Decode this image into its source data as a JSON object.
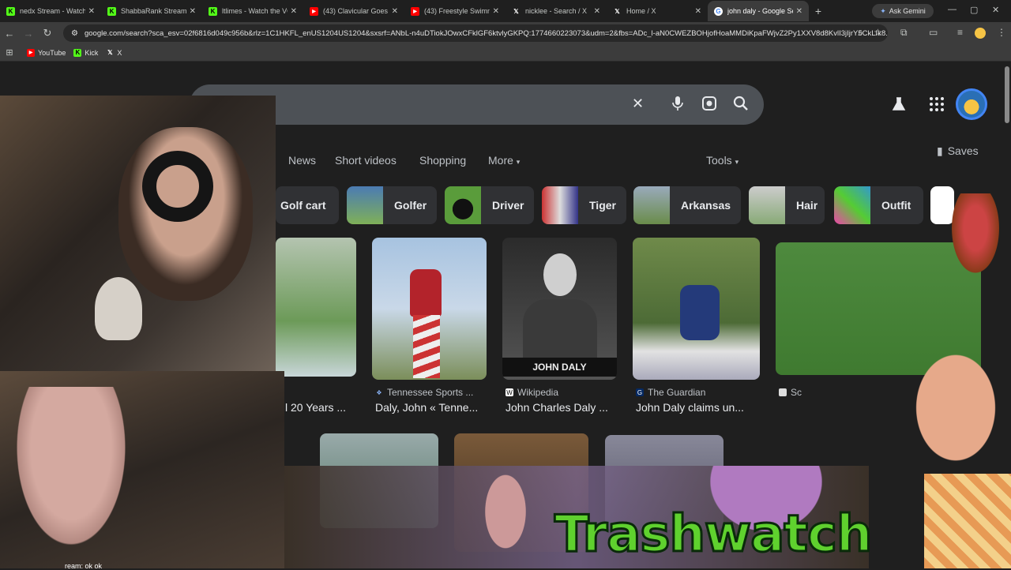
{
  "browser": {
    "tabs": [
      {
        "title": "nedx Stream - Watch L",
        "icon": "kick-icon",
        "color": "#53fc18",
        "active": false
      },
      {
        "title": "ShabbaRank Stream -",
        "icon": "kick-icon",
        "color": "#53fc18",
        "active": false
      },
      {
        "title": "ltlimes - Watch the VO",
        "icon": "kick-icon",
        "color": "#53fc18",
        "active": false
      },
      {
        "title": "(43) Clavicular Goes to",
        "icon": "youtube-icon",
        "color": "#ff0000",
        "active": false
      },
      {
        "title": "(43) Freestyle Swimmin",
        "icon": "youtube-icon",
        "color": "#ff0000",
        "active": false
      },
      {
        "title": "nicklee - Search / X",
        "icon": "x-icon",
        "color": "#ffffff",
        "active": false
      },
      {
        "title": "Home / X",
        "icon": "x-icon",
        "color": "#ffffff",
        "active": false
      },
      {
        "title": "john daly - Google Sea",
        "icon": "google-icon",
        "color": "#4285f4",
        "active": true
      }
    ],
    "new_tab": "+",
    "ask_gemini": "Ask Gemini",
    "url": "google.com/search?sca_esv=02f6816d049c956b&rlz=1C1HKFL_enUS1204US1204&sxsrf=ANbL-n4uDTiokJOwxCFklGF6ktvlyGKPQ:1774660223073&udm=2&fbs=ADc_l-aN0CWEZBOHjofHoaMMDiKpaFWjvZ2Py1XXV8d8KvlI3jIjrY5CkLIk8...",
    "bookmarks": [
      {
        "label": "YouTube",
        "icon": "youtube-icon",
        "color": "#ff0000"
      },
      {
        "label": "Kick",
        "icon": "kick-icon",
        "color": "#53fc18"
      },
      {
        "label": "X",
        "icon": "x-icon",
        "color": "#ffffff"
      }
    ]
  },
  "search": {
    "clear_icon": "close-icon",
    "mic_icon": "mic-icon",
    "lens_icon": "lens-icon",
    "search_icon": "search-icon"
  },
  "nav": {
    "tabs": [
      "News",
      "Short videos",
      "Shopping",
      "More"
    ],
    "tools": "Tools",
    "saves": "Saves"
  },
  "chips": [
    {
      "label": "Golf cart"
    },
    {
      "label": "Golfer"
    },
    {
      "label": "Driver"
    },
    {
      "label": "Tiger"
    },
    {
      "label": "Arkansas"
    },
    {
      "label": "Hair"
    },
    {
      "label": "Outfit"
    }
  ],
  "results": [
    {
      "source": "",
      "caption": "l 20 Years ..."
    },
    {
      "source": "Tennessee Sports ...",
      "caption": "Daly, John « Tenne..."
    },
    {
      "source": "Wikipedia",
      "caption": "John Charles Daly ..."
    },
    {
      "source": "The Guardian",
      "caption": "John Daly claims un..."
    },
    {
      "source": "Sc",
      "caption": ""
    }
  ],
  "nameplate": "JOHN DALY",
  "overlay": {
    "logo": "Trashwatch",
    "stream_text": "ream: ok ok"
  }
}
